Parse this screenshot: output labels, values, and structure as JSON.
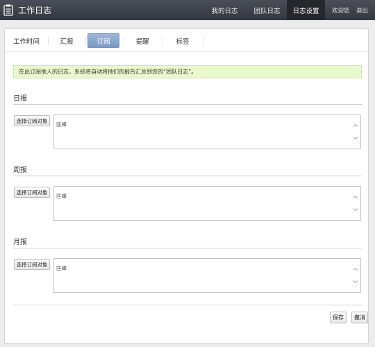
{
  "header": {
    "title": "工作日志",
    "nav": [
      "我的日志",
      "团队日志",
      "日志设置"
    ],
    "active_nav": 2,
    "welcome": "欢迎您",
    "logout": "退出"
  },
  "tabs": [
    "工作时间",
    "汇报",
    "订阅",
    "提醒",
    "标签"
  ],
  "active_tab": 2,
  "notice": "在此订阅他人的日志，系统将自动将他们的报告汇总到您的“团队日志”。",
  "sections": [
    {
      "title": "日报",
      "button": "选择订阅对象",
      "value": "匡峰"
    },
    {
      "title": "周报",
      "button": "选择订阅对象",
      "value": "匡峰"
    },
    {
      "title": "月报",
      "button": "选择订阅对象",
      "value": "匡峰"
    }
  ],
  "actions": {
    "save": "保存",
    "cancel": "撤消"
  }
}
